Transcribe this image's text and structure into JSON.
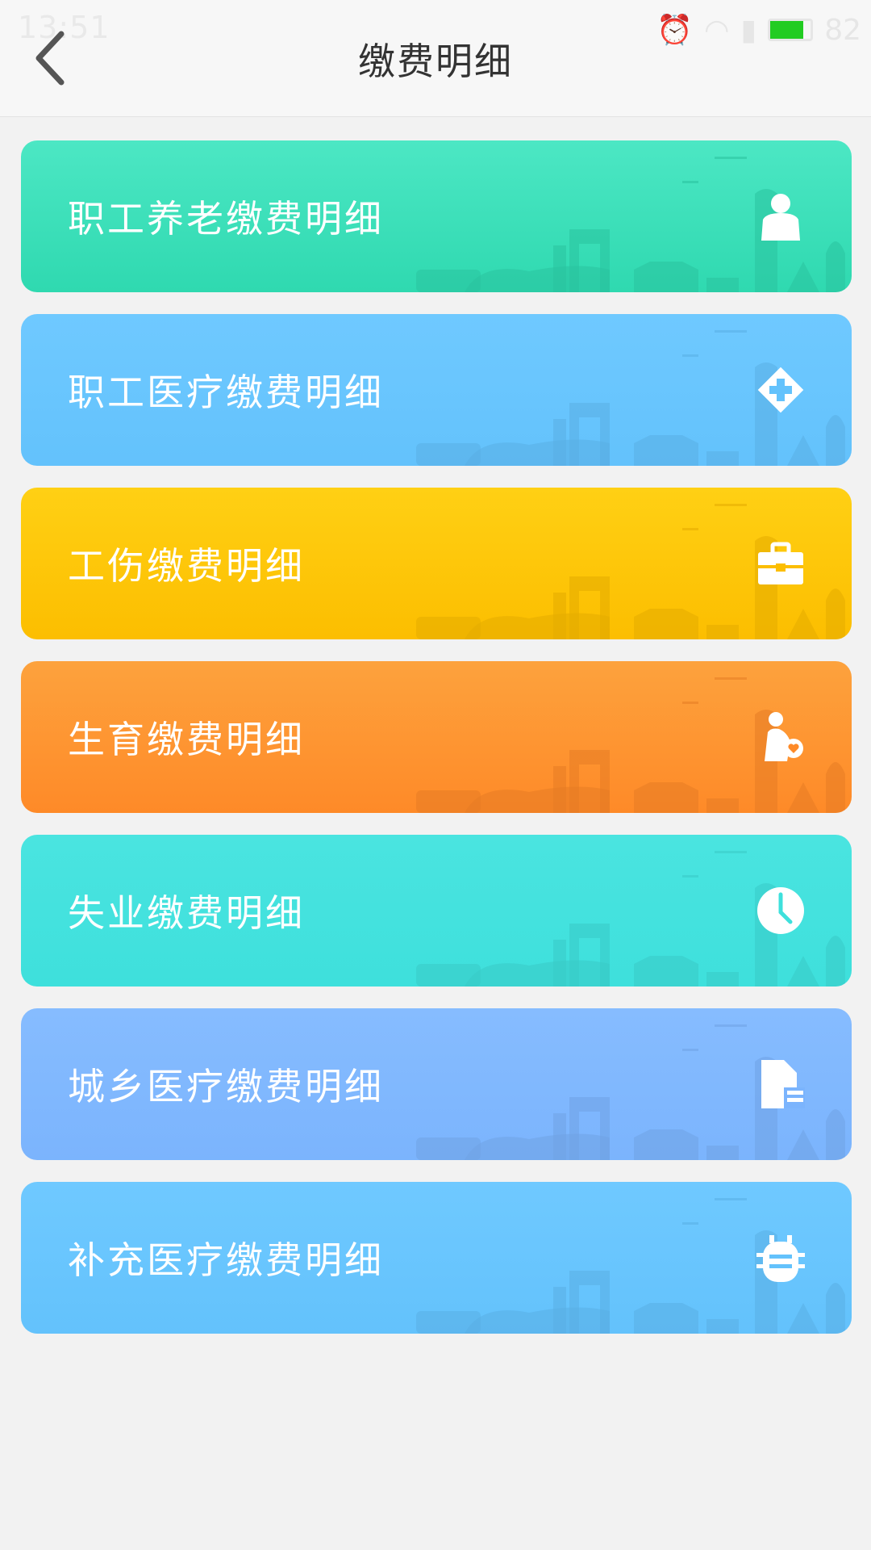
{
  "status_bar": {
    "time": "13:51",
    "battery_level": "82",
    "battery_color": "#22cc22"
  },
  "header": {
    "back_icon": "chevron-left-icon",
    "title": "缴费明细"
  },
  "cards": [
    {
      "label": "职工养老缴费明细",
      "icon": "person-icon",
      "color_top": "#4ce7c4",
      "color_bottom": "#2fd9b0"
    },
    {
      "label": "职工医疗缴费明细",
      "icon": "medical-cross-icon",
      "color_top": "#6fc9ff",
      "color_bottom": "#63c2fc"
    },
    {
      "label": "工伤缴费明细",
      "icon": "medkit-icon",
      "color_top": "#ffd014",
      "color_bottom": "#fcbe00"
    },
    {
      "label": "生育缴费明细",
      "icon": "maternity-icon",
      "color_top": "#fda23d",
      "color_bottom": "#fe8a28"
    },
    {
      "label": "失业缴费明细",
      "icon": "clock-icon",
      "color_top": "#4ae4e0",
      "color_bottom": "#3ee0dc"
    },
    {
      "label": "城乡医疗缴费明细",
      "icon": "document-icon",
      "color_top": "#86bcff",
      "color_bottom": "#7bb4fd"
    },
    {
      "label": "补充医疗缴费明细",
      "icon": "bug-icon",
      "color_top": "#6fc9ff",
      "color_bottom": "#63c2fc"
    }
  ]
}
